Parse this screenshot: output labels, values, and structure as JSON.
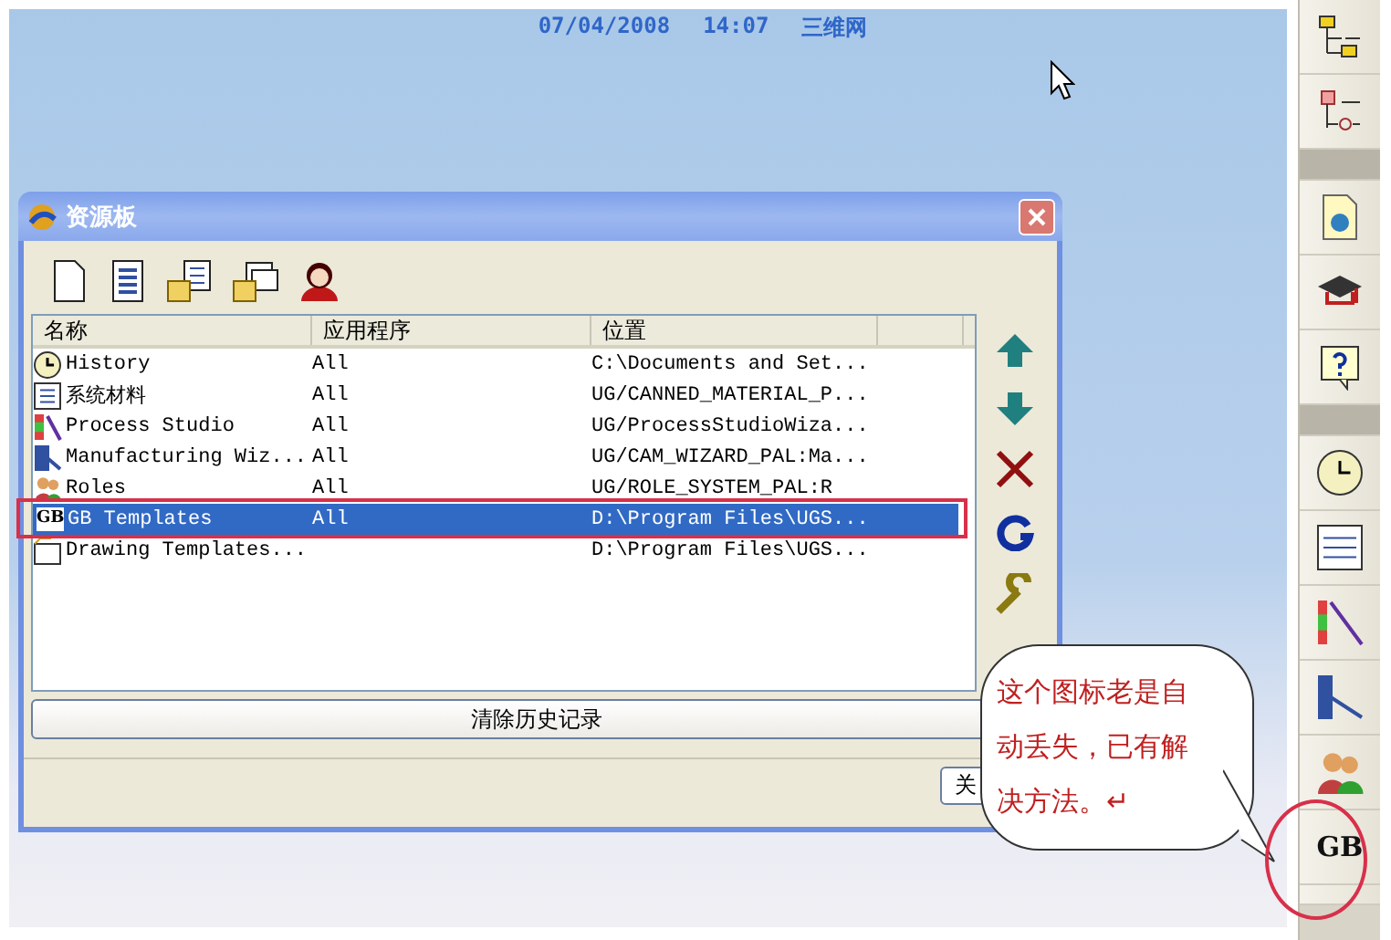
{
  "header": {
    "date": "07/04/2008",
    "time": "14:07",
    "site": "三维网"
  },
  "dialog": {
    "title": "资源板",
    "columns": [
      "名称",
      "应用程序",
      "位置"
    ],
    "rows": [
      {
        "kind": "clock",
        "name": "History",
        "app": "All",
        "location": "C:\\Documents and Set...",
        "selected": false
      },
      {
        "kind": "book",
        "name": "系统材料",
        "app": "All",
        "location": "UG/CANNED_MATERIAL_P...",
        "selected": false
      },
      {
        "kind": "rainbow",
        "name": "Process Studio",
        "app": "All",
        "location": "UG/ProcessStudioWiza...",
        "selected": false
      },
      {
        "kind": "machine",
        "name": "Manufacturing Wiz...",
        "app": "All",
        "location": "UG/CAM_WIZARD_PAL:Ma...",
        "selected": false
      },
      {
        "kind": "people",
        "name": "Roles",
        "app": "All",
        "location": "UG/ROLE_SYSTEM_PAL:R",
        "selected": false
      },
      {
        "kind": "text",
        "icon_text": "GB",
        "name": "GB Templates",
        "app": "All",
        "location": "D:\\Program Files\\UGS...",
        "selected": true
      },
      {
        "kind": "folder",
        "name": "Drawing Templates...",
        "location": "D:\\Program Files\\UGS...",
        "selected": false
      }
    ],
    "clear_button": "清除历史记录",
    "close_button": "关"
  },
  "callout": {
    "lines": [
      "这个图标老是自",
      "动丢失，已有解",
      "决方法。↵"
    ]
  },
  "sidebar": [
    {
      "kind": "tree"
    },
    {
      "kind": "tree2"
    },
    {
      "kind": "gap"
    },
    {
      "kind": "doc"
    },
    {
      "kind": "cap"
    },
    {
      "kind": "help"
    },
    {
      "kind": "gap"
    },
    {
      "kind": "clock"
    },
    {
      "kind": "list"
    },
    {
      "kind": "rainbow"
    },
    {
      "kind": "machine"
    },
    {
      "kind": "people"
    },
    {
      "kind": "text",
      "label": "GB"
    },
    {
      "kind": "partial"
    }
  ]
}
